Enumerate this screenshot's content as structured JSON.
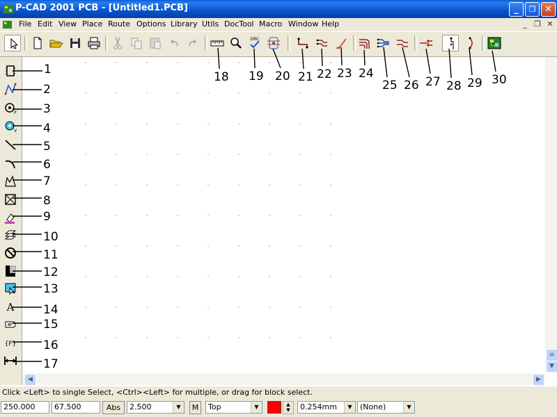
{
  "window": {
    "title": "P-CAD 2001 PCB - [Untitled1.PCB]",
    "minimize": "_",
    "restore": "❐",
    "close": "✕"
  },
  "menu": [
    "File",
    "Edit",
    "View",
    "Place",
    "Route",
    "Options",
    "Library",
    "Utils",
    "DocTool",
    "Macro",
    "Window",
    "Help"
  ],
  "mdi_controls": [
    "_",
    "❐",
    "✕"
  ],
  "toolbar_callouts": [
    "18",
    "19",
    "20",
    "21",
    "22",
    "23",
    "24",
    "25",
    "26",
    "27",
    "28",
    "29",
    "30"
  ],
  "drc_label": "DRC",
  "left_callouts": [
    "1",
    "2",
    "3",
    "4",
    "5",
    "6",
    "7",
    "8",
    "9",
    "10",
    "11",
    "12",
    "13",
    "14",
    "15",
    "16",
    "17"
  ],
  "left_tools": [
    "select-component",
    "route-manual",
    "pad",
    "via",
    "line",
    "arc",
    "polygon",
    "copper-pour",
    "fill",
    "plane",
    "keepout",
    "cutout",
    "point",
    "text",
    "attribute",
    "field",
    "dimension"
  ],
  "left_text_glyphs": {
    "text": "A",
    "field": "{F}"
  },
  "status": {
    "message": "Click <Left> to single Select, <Ctrl><Left> for multiple, or drag for block select.",
    "x_coord": "250.000",
    "y_coord": "67.500",
    "abs_button": "Abs",
    "grid": "2.500",
    "m_button": "M",
    "layer": "Top",
    "layer_color": "#ff0000",
    "width": "0.254mm",
    "net": "(None)"
  },
  "colors": {
    "title_bar": "#0a5fd8",
    "chrome": "#ece9d8",
    "grid_dot": "#b8b8b8"
  }
}
